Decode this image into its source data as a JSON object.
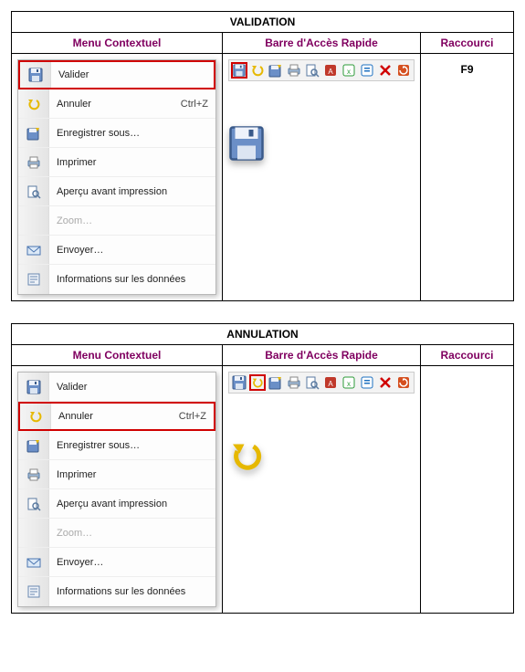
{
  "sections": [
    {
      "title": "VALIDATION",
      "headers": {
        "menu": "Menu Contextuel",
        "toolbar": "Barre d'Accès Rapide",
        "shortcut": "Raccourci"
      },
      "menu": [
        {
          "icon": "save-icon",
          "label": "Valider",
          "shortcut": "",
          "highlight": true,
          "disabled": false
        },
        {
          "icon": "undo-icon",
          "label": "Annuler",
          "shortcut": "Ctrl+Z",
          "highlight": false,
          "disabled": false
        },
        {
          "icon": "save-as-icon",
          "label": "Enregistrer sous…",
          "shortcut": "",
          "highlight": false,
          "disabled": false
        },
        {
          "icon": "print-icon",
          "label": "Imprimer",
          "shortcut": "",
          "highlight": false,
          "disabled": false
        },
        {
          "icon": "preview-icon",
          "label": "Aperçu avant impression",
          "shortcut": "",
          "highlight": false,
          "disabled": false
        },
        {
          "icon": "zoom-icon",
          "label": "Zoom…",
          "shortcut": "",
          "highlight": false,
          "disabled": true
        },
        {
          "icon": "send-icon",
          "label": "Envoyer…",
          "shortcut": "",
          "highlight": false,
          "disabled": false
        },
        {
          "icon": "info-icon",
          "label": "Informations sur les données",
          "shortcut": "",
          "highlight": false,
          "disabled": false
        }
      ],
      "toolbar_icons": [
        {
          "icon": "save-icon",
          "highlight": true
        },
        {
          "icon": "undo-icon",
          "highlight": false
        },
        {
          "icon": "save-as-icon",
          "highlight": false
        },
        {
          "icon": "print-icon",
          "highlight": false
        },
        {
          "icon": "preview-icon",
          "highlight": false
        },
        {
          "icon": "pdf-icon",
          "highlight": false
        },
        {
          "icon": "excel-icon",
          "highlight": false
        },
        {
          "icon": "doc-icon",
          "highlight": false
        },
        {
          "icon": "delete-icon",
          "highlight": false
        },
        {
          "icon": "refresh-icon",
          "highlight": false
        }
      ],
      "big_icon": "save-icon",
      "shortcut_value": "F9"
    },
    {
      "title": "ANNULATION",
      "headers": {
        "menu": "Menu Contextuel",
        "toolbar": "Barre d'Accès Rapide",
        "shortcut": "Raccourci"
      },
      "menu": [
        {
          "icon": "save-icon",
          "label": "Valider",
          "shortcut": "",
          "highlight": false,
          "disabled": false
        },
        {
          "icon": "undo-icon",
          "label": "Annuler",
          "shortcut": "Ctrl+Z",
          "highlight": true,
          "disabled": false
        },
        {
          "icon": "save-as-icon",
          "label": "Enregistrer sous…",
          "shortcut": "",
          "highlight": false,
          "disabled": false
        },
        {
          "icon": "print-icon",
          "label": "Imprimer",
          "shortcut": "",
          "highlight": false,
          "disabled": false
        },
        {
          "icon": "preview-icon",
          "label": "Aperçu avant impression",
          "shortcut": "",
          "highlight": false,
          "disabled": false
        },
        {
          "icon": "zoom-icon",
          "label": "Zoom…",
          "shortcut": "",
          "highlight": false,
          "disabled": true
        },
        {
          "icon": "send-icon",
          "label": "Envoyer…",
          "shortcut": "",
          "highlight": false,
          "disabled": false
        },
        {
          "icon": "info-icon",
          "label": "Informations sur les données",
          "shortcut": "",
          "highlight": false,
          "disabled": false
        }
      ],
      "toolbar_icons": [
        {
          "icon": "save-icon",
          "highlight": false
        },
        {
          "icon": "undo-icon",
          "highlight": true
        },
        {
          "icon": "save-as-icon",
          "highlight": false
        },
        {
          "icon": "print-icon",
          "highlight": false
        },
        {
          "icon": "preview-icon",
          "highlight": false
        },
        {
          "icon": "pdf-icon",
          "highlight": false
        },
        {
          "icon": "excel-icon",
          "highlight": false
        },
        {
          "icon": "doc-icon",
          "highlight": false
        },
        {
          "icon": "delete-icon",
          "highlight": false
        },
        {
          "icon": "refresh-icon",
          "highlight": false
        }
      ],
      "big_icon": "undo-icon",
      "shortcut_value": ""
    }
  ]
}
